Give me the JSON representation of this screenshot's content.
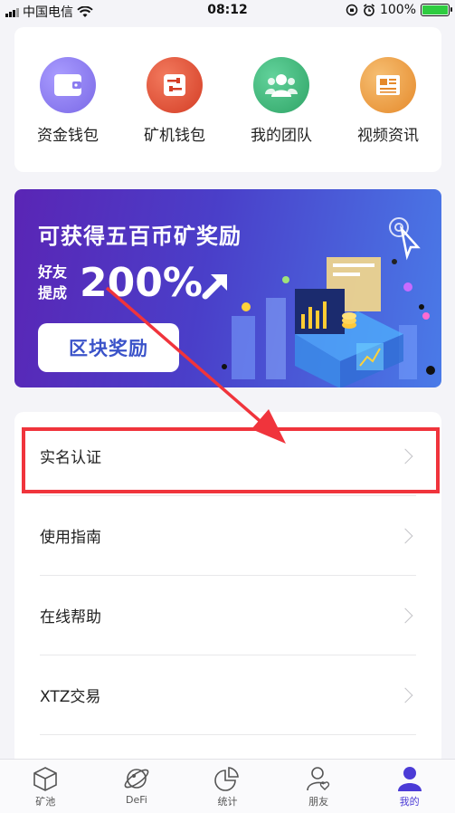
{
  "status_bar": {
    "carrier": "中国电信",
    "time": "08:12",
    "battery": "100%"
  },
  "quick_actions": [
    {
      "label": "资金钱包",
      "icon": "wallet-icon",
      "color": "#8b7cf0"
    },
    {
      "label": "矿机钱包",
      "icon": "sliders-icon",
      "color": "#e2533a"
    },
    {
      "label": "我的团队",
      "icon": "team-icon",
      "color": "#3fb37a"
    },
    {
      "label": "视频资讯",
      "icon": "news-icon",
      "color": "#f0a346"
    }
  ],
  "banner": {
    "title": "可获得五百币矿奖励",
    "subtitle_line1": "好友",
    "subtitle_line2": "提成",
    "percent": "200%",
    "button_label": "区块奖励"
  },
  "menu": {
    "items": [
      {
        "label": "实名认证"
      },
      {
        "label": "使用指南"
      },
      {
        "label": "在线帮助"
      },
      {
        "label": "XTZ交易"
      }
    ]
  },
  "tabbar": {
    "tabs": [
      {
        "label": "矿池",
        "icon": "cube-icon"
      },
      {
        "label": "DeFi",
        "icon": "planet-icon"
      },
      {
        "label": "统计",
        "icon": "pie-chart-icon"
      },
      {
        "label": "朋友",
        "icon": "friend-icon"
      },
      {
        "label": "我的",
        "icon": "person-icon"
      }
    ],
    "active": "我的"
  },
  "colors": {
    "accent": "#4b3bd6",
    "annotation": "#f0343c"
  }
}
